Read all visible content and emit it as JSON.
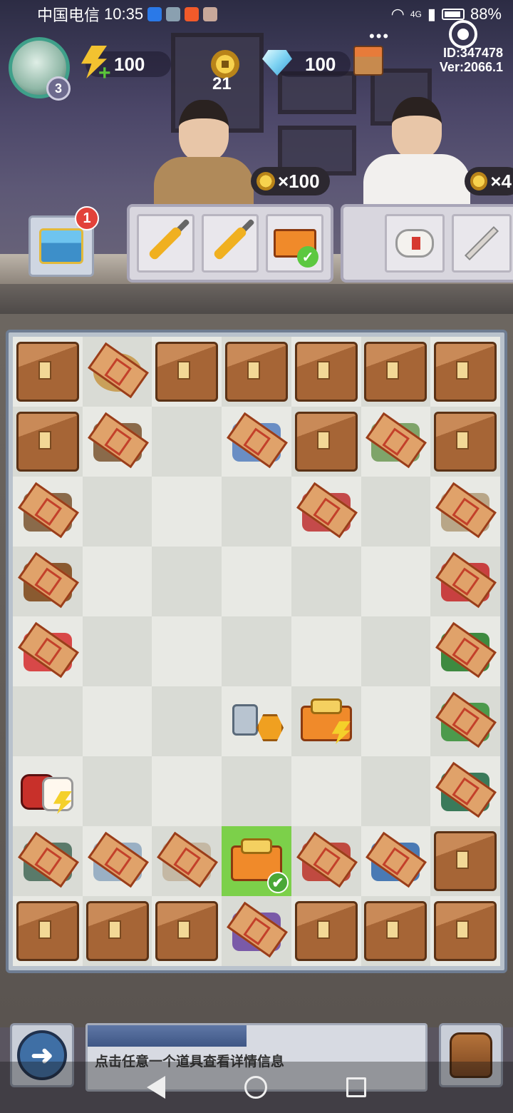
{
  "status": {
    "carrier": "中国电信",
    "time": "10:35",
    "network": "4G",
    "battery": "88%"
  },
  "header": {
    "level": "3",
    "energy": "100",
    "coins": "21",
    "diamonds": "100",
    "player_id": "ID:347478",
    "version": "Ver:2066.1",
    "dots": "•••"
  },
  "orders": [
    {
      "reward": "×100",
      "items": [
        "screwdriver-icon",
        "screwdriver-icon",
        "toolbox-icon"
      ]
    },
    {
      "reward": "×4",
      "items": [
        "bandage-icon",
        "cotton-swab-icon"
      ]
    }
  ],
  "chest": {
    "badge": "1"
  },
  "board": {
    "rows": [
      [
        "box",
        "coin-wrapped",
        "box",
        "box",
        "box",
        "box",
        "box"
      ],
      [
        "box",
        "wrapped-plank",
        "",
        "wrapped-slippers",
        "box",
        "wrapped-pliers",
        "box"
      ],
      [
        "wrapped-plank",
        "",
        "",
        "",
        "wrapped-toaster",
        "",
        "wrapped-board"
      ],
      [
        "wrapped-rope",
        "",
        "",
        "",
        "",
        "",
        "wrapped-lunchbox"
      ],
      [
        "wrapped-thermometer",
        "",
        "",
        "",
        "",
        "",
        "wrapped-bag"
      ],
      [
        "",
        "",
        "",
        "bolt-nut",
        "toolbox-glowing",
        "",
        "wrapped-wrench"
      ],
      [
        "medkit-glowing",
        "",
        "",
        "",
        "",
        "",
        "wrapped-tape"
      ],
      [
        "wrapped-camera",
        "wrapped-photo",
        "wrapped-photos",
        "toolbox-selected",
        "wrapped-tool",
        "wrapped-tube",
        "box"
      ],
      [
        "box",
        "box",
        "box",
        "wrapped-cloth",
        "box",
        "box",
        "box"
      ]
    ],
    "selected_tick": "✔"
  },
  "footer": {
    "back_label": "➜",
    "hint": "点击任意一个道具查看详情信息",
    "progress": 0.47
  },
  "colors": {
    "accent_green": "#7cd04a",
    "board_border": "#6f7d92"
  }
}
